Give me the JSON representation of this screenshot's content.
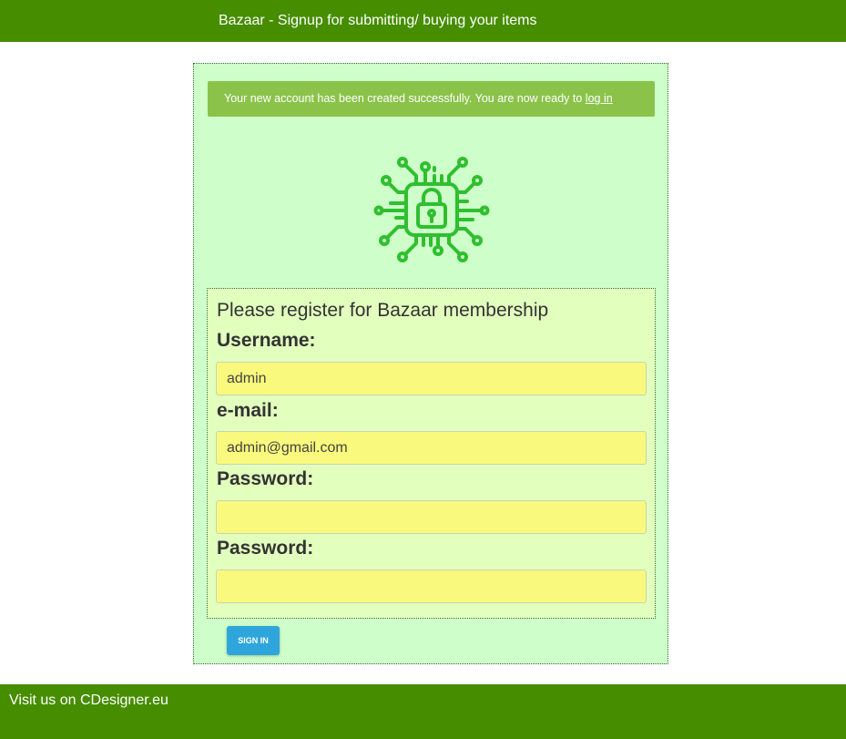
{
  "header": {
    "title": "Bazaar - Signup for submitting/ buying your items"
  },
  "alert": {
    "message": "Your new account has been created successfully. You are now ready to ",
    "link_label": "log in",
    "color": "#8bc34a"
  },
  "logo": {
    "icon": "circuit-lock-icon",
    "color": "#2fbf2f"
  },
  "form": {
    "title": "Please register for Bazaar membership",
    "username_label": "Username:",
    "username_value": "admin",
    "email_label": "e-mail:",
    "email_value": "admin@gmail.com",
    "password_label": "Password:",
    "password_value": "",
    "password_confirm_label": "Password:",
    "password_confirm_value": "",
    "submit_label": "SIGN IN"
  },
  "footer": {
    "text": "Visit us on CDesigner.eu"
  },
  "colors": {
    "bar": "#468d00",
    "panel": "#ceffca",
    "form_box": "#e2ffbe",
    "input": "#f9f97d",
    "button": "#2ea6dc"
  }
}
